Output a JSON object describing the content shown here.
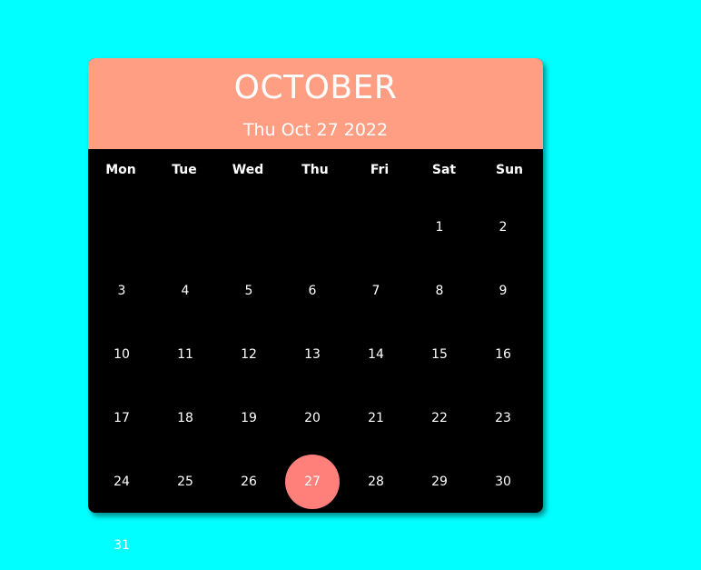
{
  "calendar": {
    "month_title": "OCTOBER",
    "selected_date_text": "Thu Oct 27 2022",
    "weekdays": [
      "Mon",
      "Tue",
      "Wed",
      "Thu",
      "Fri",
      "Sat",
      "Sun"
    ],
    "days": [
      "1",
      "2",
      "3",
      "4",
      "5",
      "6",
      "7",
      "8",
      "9",
      "10",
      "11",
      "12",
      "13",
      "14",
      "15",
      "16",
      "17",
      "18",
      "19",
      "20",
      "21",
      "22",
      "23",
      "24",
      "25",
      "26",
      "27",
      "28",
      "29",
      "30"
    ],
    "overflow_day": "31",
    "selected_day": "27"
  },
  "colors": {
    "page_background": "#00ffff",
    "header_background": "#ff9e82",
    "calendar_background": "#000000",
    "selected_day_background": "#ff7f7a",
    "text": "#ffffff"
  }
}
